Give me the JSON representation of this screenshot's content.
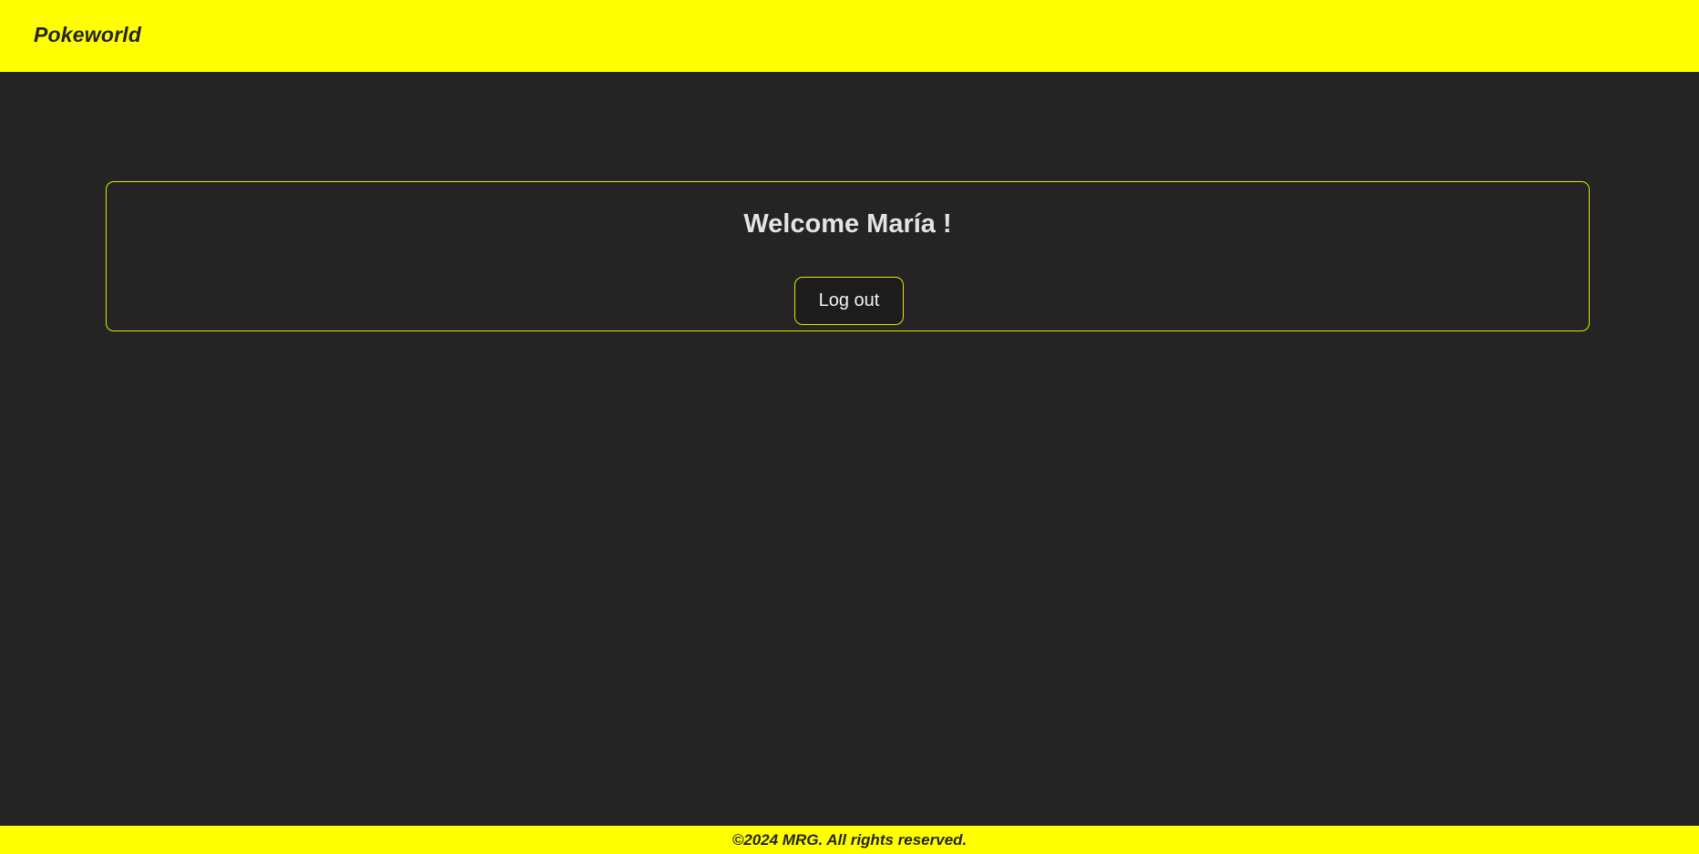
{
  "header": {
    "brand": "Pokeworld"
  },
  "main": {
    "welcome_title": "Welcome María !",
    "logout_label": "Log out"
  },
  "footer": {
    "copyright": "©2024 MRG. All rights reserved."
  },
  "colors": {
    "accent": "#ffff00",
    "background": "#242424",
    "card_border": "#e6e600",
    "text_light": "#e4e4e4"
  }
}
